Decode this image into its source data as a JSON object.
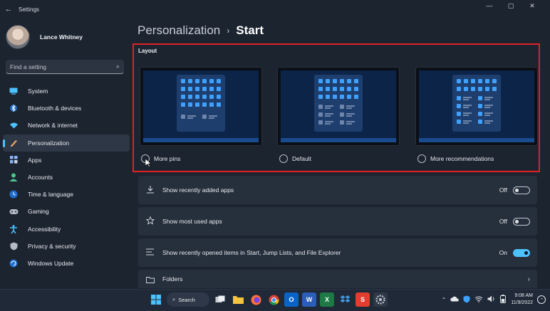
{
  "window": {
    "back_glyph": "←",
    "title": "Settings",
    "controls": [
      "—",
      "▢",
      "✕"
    ]
  },
  "profile": {
    "name": "Lance Whitney"
  },
  "search": {
    "placeholder": "Find a setting",
    "icon": "search-icon"
  },
  "sidebar": {
    "items": [
      {
        "label": "System",
        "icon": "monitor-icon",
        "color": "#4cc2ff",
        "active": false
      },
      {
        "label": "Bluetooth & devices",
        "icon": "bluetooth-icon",
        "color": "#4cc2ff",
        "active": false
      },
      {
        "label": "Network & internet",
        "icon": "wifi-icon",
        "color": "#4cc2ff",
        "active": false
      },
      {
        "label": "Personalization",
        "icon": "brush-icon",
        "color": "#f0a860",
        "active": true
      },
      {
        "label": "Apps",
        "icon": "apps-icon",
        "color": "#8ab4f8",
        "active": false
      },
      {
        "label": "Accounts",
        "icon": "person-icon",
        "color": "#4fc48b",
        "active": false
      },
      {
        "label": "Time & language",
        "icon": "globe-clock-icon",
        "color": "#4cc2ff",
        "active": false
      },
      {
        "label": "Gaming",
        "icon": "controller-icon",
        "color": "#b5bcc6",
        "active": false
      },
      {
        "label": "Accessibility",
        "icon": "accessibility-icon",
        "color": "#4cc2ff",
        "active": false
      },
      {
        "label": "Privacy & security",
        "icon": "shield-icon",
        "color": "#b5bcc6",
        "active": false
      },
      {
        "label": "Windows Update",
        "icon": "update-icon",
        "color": "#4cc2ff",
        "active": false
      }
    ]
  },
  "breadcrumb": {
    "parent": "Personalization",
    "separator": "›",
    "current": "Start"
  },
  "layout": {
    "title": "Layout",
    "options": [
      {
        "label": "More pins",
        "selected": false
      },
      {
        "label": "Default",
        "selected": false
      },
      {
        "label": "More recommendations",
        "selected": false
      }
    ]
  },
  "settings": [
    {
      "label": "Show recently added apps",
      "icon": "download-icon",
      "state": "Off",
      "on": false
    },
    {
      "label": "Show most used apps",
      "icon": "star-icon",
      "state": "Off",
      "on": false
    },
    {
      "label": "Show recently opened items in Start, Jump Lists, and File Explorer",
      "icon": "list-icon",
      "state": "On",
      "on": true
    },
    {
      "label": "Folders",
      "icon": "folder-icon",
      "chevron": "›"
    }
  ],
  "taskbar": {
    "search_label": "Search",
    "apps": [
      "windows-start-icon",
      "task-view-icon",
      "file-explorer-icon",
      "firefox-icon",
      "chrome-icon",
      "outlook-icon",
      "word-icon",
      "excel-icon",
      "dropbox-icon",
      "snagit-icon",
      "settings-icon"
    ],
    "time": "9:08 AM",
    "date": "11/9/2022"
  },
  "accent_color": "#4cc2ff",
  "highlight_box_color": "#e31f26"
}
